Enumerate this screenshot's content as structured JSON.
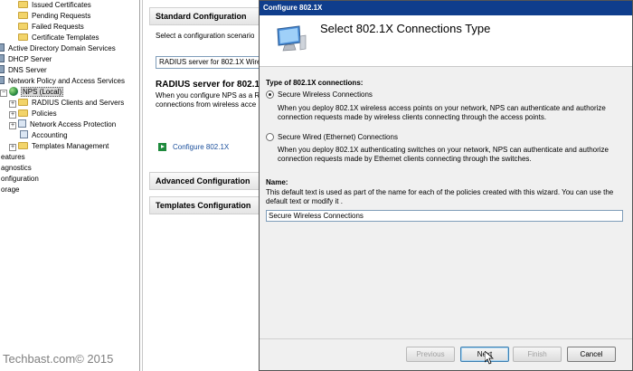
{
  "tree": {
    "items": [
      {
        "label": "Issued Certificates",
        "icon": "folder-icon"
      },
      {
        "label": "Pending Requests",
        "icon": "folder-icon"
      },
      {
        "label": "Failed Requests",
        "icon": "folder-icon"
      },
      {
        "label": "Certificate Templates",
        "icon": "folder-icon"
      },
      {
        "label": "Active Directory Domain Services",
        "icon": "server-icon"
      },
      {
        "label": "DHCP Server",
        "icon": "server-icon"
      },
      {
        "label": "DNS Server",
        "icon": "server-icon"
      },
      {
        "label": "Network Policy and Access Services",
        "icon": "server-icon"
      },
      {
        "label": "NPS (Local)",
        "icon": "globe-icon"
      },
      {
        "label": "RADIUS Clients and Servers",
        "icon": "folder-icon"
      },
      {
        "label": "Policies",
        "icon": "folder-icon"
      },
      {
        "label": "Network Access Protection",
        "icon": "shield-icon"
      },
      {
        "label": "Accounting",
        "icon": "accounting-icon"
      },
      {
        "label": "Templates Management",
        "icon": "folder-icon"
      },
      {
        "label": "eatures"
      },
      {
        "label": "agnostics"
      },
      {
        "label": "onfiguration"
      },
      {
        "label": "orage"
      }
    ]
  },
  "watermark": "Techbast.com© 2015",
  "mid": {
    "standard_title": "Standard Configuration",
    "scenario_prompt": "Select a configuration scenario",
    "scenario_value": "RADIUS server for 802.1X Wire",
    "heading": "RADIUS server for 802.1",
    "desc_line1": "When you configure NPS as a R",
    "desc_line2": "connections from wireless acce",
    "link": "Configure 802.1X",
    "advanced_title": "Advanced Configuration",
    "templates_title": "Templates Configuration"
  },
  "dialog": {
    "title": "Configure 802.1X",
    "header_title": "Select 802.1X Connections Type",
    "type_label": "Type of 802.1X connections:",
    "option_wireless": "Secure Wireless Connections",
    "option_wireless_selected": true,
    "wireless_desc": "When you deploy 802.1X wireless access points on your network, NPS can authenticate and authorize connection requests made by wireless clients connecting through the access points.",
    "option_wired": "Secure Wired (Ethernet) Connections",
    "option_wired_selected": false,
    "wired_desc": "When you deploy 802.1X authenticating switches on your network, NPS can authenticate and authorize connection requests made by Ethernet clients connecting through the switches.",
    "name_label": "Name:",
    "name_desc": "This default text is used as part of the name for each of the policies created with this wizard. You can use the default text or modify it .",
    "name_value": "Secure Wireless Connections",
    "buttons": {
      "previous": "Previous",
      "next": "Next",
      "finish": "Finish",
      "cancel": "Cancel"
    }
  }
}
